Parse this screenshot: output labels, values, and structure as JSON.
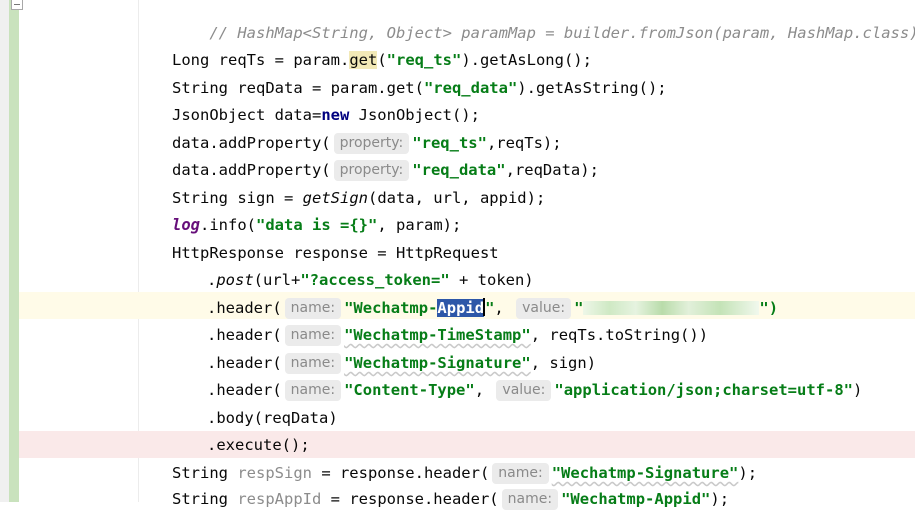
{
  "editor": {
    "colors": {
      "background": "#ffffff",
      "current_line": "#fffbe8",
      "breakpoint_line": "#fae9e9",
      "change_bar": "#c9e2bd",
      "string": "#067d17",
      "keyword": "#000080",
      "comment": "#8c8c8c",
      "hint_bg": "#ebebeb",
      "selection": "#2d57a8"
    },
    "icons": {
      "fold": "fold-collapse-icon"
    },
    "lines": {
      "l0": {
        "text": "// HashMap<String, Object> paramMap = builder.fromJson(param, HashMap.class);"
      },
      "l1": {
        "a": "Long reqTs = param.",
        "b": "get",
        "c": "(",
        "d": "\"req_ts\"",
        "e": ").getAsLong();"
      },
      "l2": {
        "a": "String reqData = param.get(",
        "b": "\"req_data\"",
        "c": ").getAsString();"
      },
      "l3": {
        "a": "JsonObject data=",
        "b": "new",
        "c": " JsonObject();"
      },
      "l4": {
        "a": "data.addProperty(",
        "hint": "property:",
        "b": "\"req_ts\"",
        "c": ",reqTs);"
      },
      "l5": {
        "a": "data.addProperty(",
        "hint": "property:",
        "b": "\"req_data\"",
        "c": ",reqData);"
      },
      "l6": {
        "a": "String sign = ",
        "b": "getSign",
        "c": "(data, url, appid);"
      },
      "l7": {
        "a": "log",
        "b": ".info(",
        "c": "\"data is ={}\"",
        "d": ", param);"
      },
      "l8": {
        "text": "HttpResponse response = HttpRequest"
      },
      "l9": {
        "a": ".",
        "b": "post",
        "c": "(url+",
        "d": "\"?access_token=\"",
        "e": " + token)"
      },
      "l10": {
        "a": ".header(",
        "hint1": "name:",
        "b": "\"Wechatmp-",
        "sel": "Appid",
        "c": "\"",
        "d": ", ",
        "hint2": "value:",
        "e": "\"",
        "f": "\")"
      },
      "l11": {
        "a": ".header(",
        "hint": "name:",
        "b": "\"Wechatmp-TimeStamp\"",
        "c": ", reqTs.toString())"
      },
      "l12": {
        "a": ".header(",
        "hint": "name:",
        "b": "\"Wechatmp-Signature\"",
        "c": ", sign)"
      },
      "l13": {
        "a": ".header(",
        "hint1": "name:",
        "b": "\"Content-Type\"",
        "c": ", ",
        "hint2": "value:",
        "d": "\"application/json;charset=utf-8\"",
        "e": ")"
      },
      "l14": {
        "text": ".body(reqData)"
      },
      "l15": {
        "text": ".execute();"
      },
      "l16": {
        "a": "String ",
        "b": "respSign",
        "c": " = response.header(",
        "hint": "name:",
        "d": "\"Wechatmp-Signature\"",
        "e": ");"
      },
      "l17": {
        "a": "String ",
        "b": "respAppId",
        "c": " = response.header(",
        "hint": "name:",
        "d": "\"Wechatmp-Appid\"",
        "e": ");"
      }
    }
  }
}
